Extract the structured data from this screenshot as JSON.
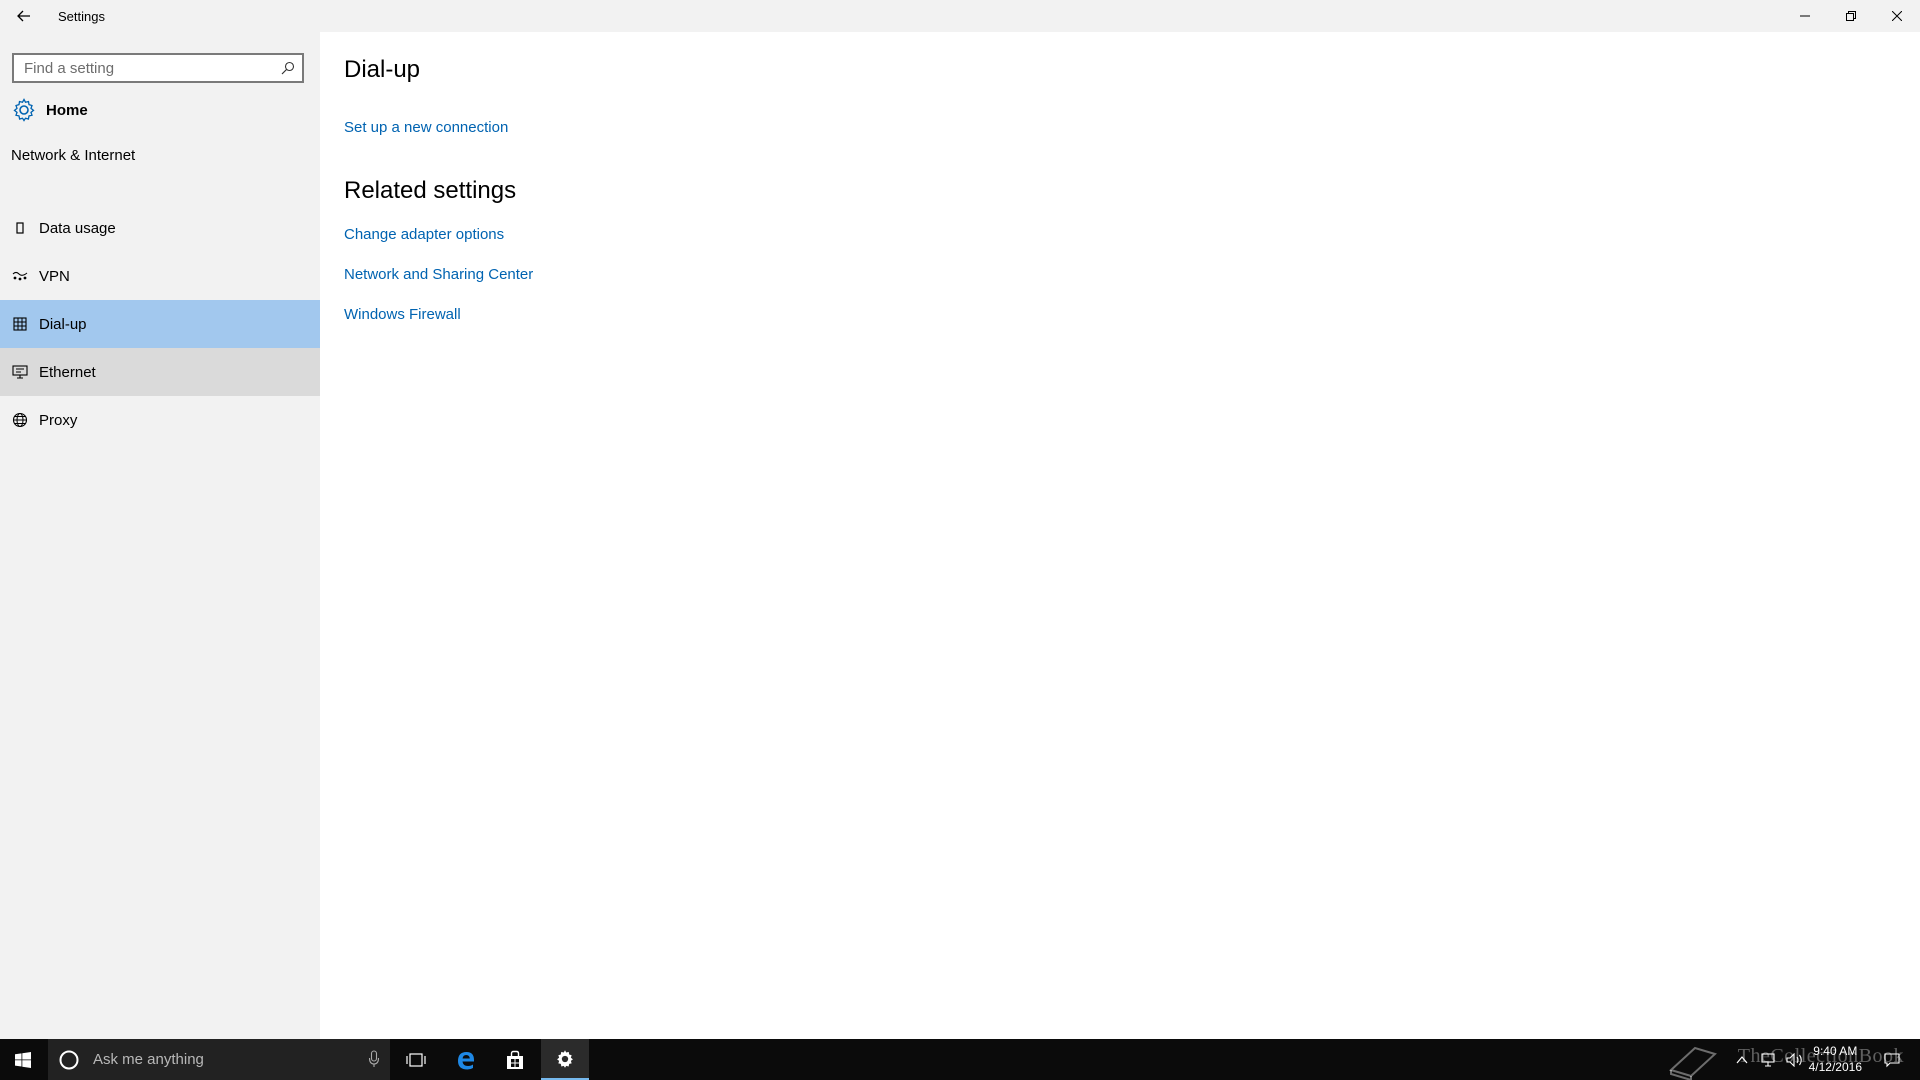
{
  "window": {
    "title": "Settings"
  },
  "sidebar": {
    "search_placeholder": "Find a setting",
    "home_label": "Home",
    "section_title": "Network & Internet",
    "items": [
      {
        "label": "Data usage",
        "icon": "data-usage-icon",
        "state": "normal"
      },
      {
        "label": "VPN",
        "icon": "vpn-icon",
        "state": "normal"
      },
      {
        "label": "Dial-up",
        "icon": "dial-up-icon",
        "state": "selected"
      },
      {
        "label": "Ethernet",
        "icon": "ethernet-icon",
        "state": "hovered"
      },
      {
        "label": "Proxy",
        "icon": "globe-icon",
        "state": "normal"
      }
    ]
  },
  "main": {
    "title": "Dial-up",
    "setup_link": "Set up a new connection",
    "related_title": "Related settings",
    "related_links": [
      "Change adapter options",
      "Network and Sharing Center",
      "Windows Firewall"
    ]
  },
  "taskbar": {
    "search_placeholder": "Ask me anything",
    "time": "9:40 AM",
    "date": "4/12/2016",
    "watermark": "TheCollectionBook"
  },
  "colors": {
    "accent": "#0063b1",
    "selected_bg": "#a2c8ee",
    "hover_bg": "#dadada",
    "sidebar_bg": "#f2f2f2",
    "taskbar_bg": "#0b0b0b"
  }
}
